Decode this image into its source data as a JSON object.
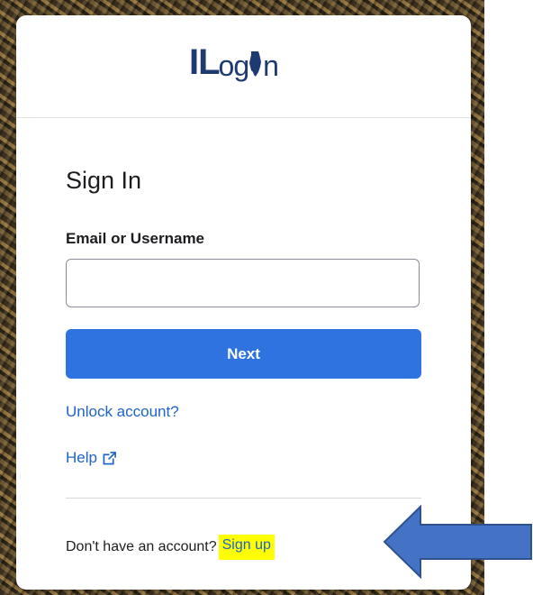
{
  "logo": {
    "part1": "IL",
    "part2": "og",
    "part3": "n"
  },
  "form": {
    "title": "Sign In",
    "field_label": "Email or Username",
    "field_value": "",
    "next_label": "Next"
  },
  "links": {
    "unlock": "Unlock account?",
    "help": "Help"
  },
  "signup": {
    "prompt": "Don't have an account?",
    "link": "Sign up"
  },
  "colors": {
    "brand": "#1d3a72",
    "button": "#2e73e0",
    "link": "#1f63c8",
    "highlight": "#ffff00",
    "arrow": "#4472c4"
  },
  "icons": {
    "external": "external-link-icon",
    "state": "illinois-state-icon",
    "arrow": "pointer-arrow-icon"
  }
}
